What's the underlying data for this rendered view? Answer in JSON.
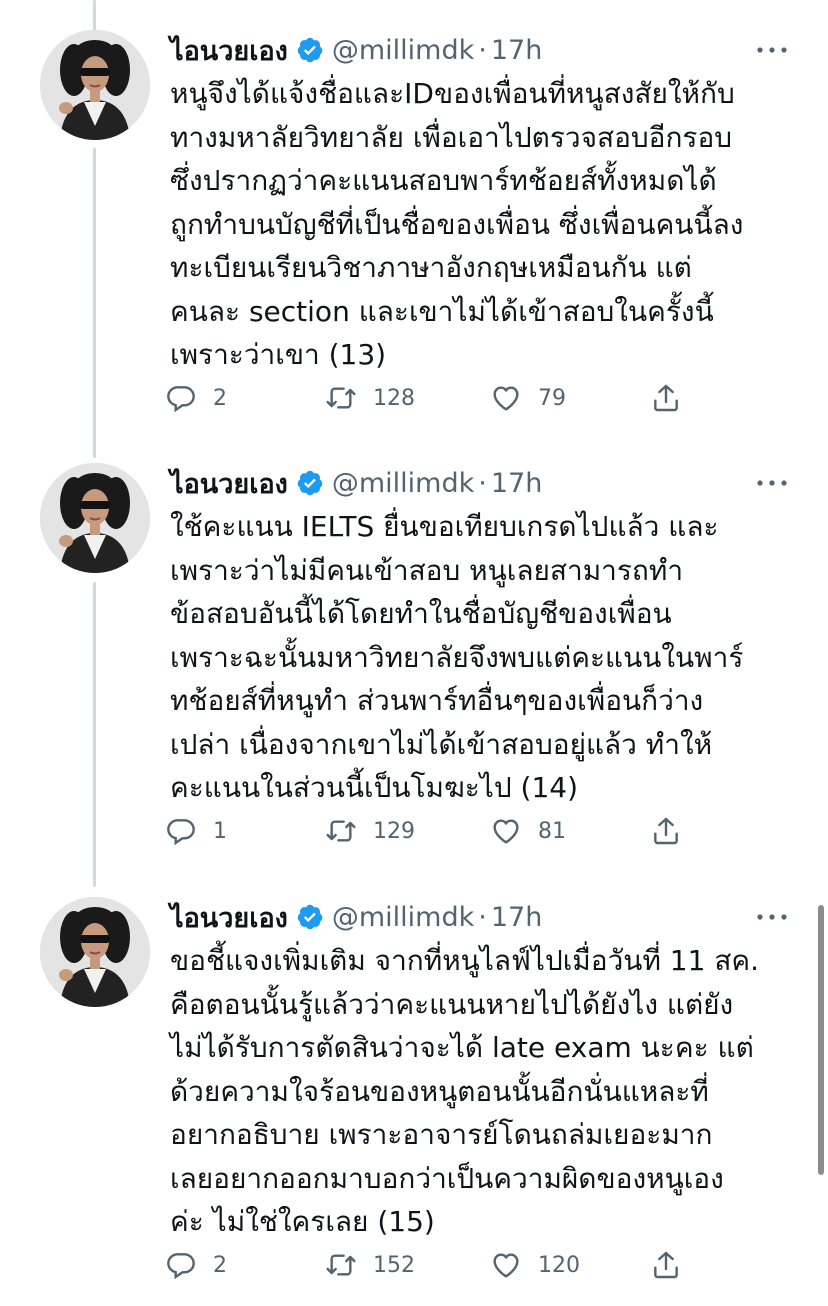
{
  "tweets": [
    {
      "display_name": "ไอนวยเอง",
      "handle": "@millimdk",
      "separator": "·",
      "time": "17h",
      "lines": [
        "หนูจึงได้แจ้งชื่อและIDของเพื่อนที่หนูสงสัยให้กับ",
        "ทางมหาลัยวิทยาลัย เพื่อเอาไปตรวจสอบอีกรอบ",
        "ซึ่งปรากฏว่าคะแนนสอบพาร์ทช้อยส์ทั้งหมดได้",
        "ถูกทำบนบัญชีที่เป็นชื่อของเพื่อน ซึ่งเพื่อนคนนี้ลง",
        "ทะเบียนเรียนวิชาภาษาอังกฤษเหมือนกัน แต่",
        "คนละ section และเขาไม่ได้เข้าสอบในครั้งนี้",
        "เพราะว่าเขา (13)"
      ],
      "replies": "2",
      "retweets": "128",
      "likes": "79"
    },
    {
      "display_name": "ไอนวยเอง",
      "handle": "@millimdk",
      "separator": "·",
      "time": "17h",
      "lines": [
        "ใช้คะแนน IELTS ยื่นขอเทียบเกรดไปแล้ว และ",
        "เพราะว่าไม่มีคนเข้าสอบ หนูเลยสามารถทำ",
        "ข้อสอบอันนี้ได้โดยทำในชื่อบัญชีของเพื่อน",
        "เพราะฉะนั้นมหาวิทยาลัยจึงพบแต่คะแนนในพาร์",
        "ทช้อยส์ที่หนูทำ ส่วนพาร์ทอื่นๆของเพื่อนก็ว่าง",
        "เปล่า เนื่องจากเขาไม่ได้เข้าสอบอยู่แล้ว ทำให้",
        "คะแนนในส่วนนี้เป็นโมฆะไป (14)"
      ],
      "replies": "1",
      "retweets": "129",
      "likes": "81"
    },
    {
      "display_name": "ไอนวยเอง",
      "handle": "@millimdk",
      "separator": "·",
      "time": "17h",
      "lines": [
        "ขอชี้แจงเพิ่มเติม จากที่หนูไลฟ์ไปเมื่อวันที่ 11 สค.",
        "คือตอนนั้นรู้แล้วว่าคะแนนหายไปได้ยังไง แต่ยัง",
        "ไม่ได้รับการตัดสินว่าจะได้ late exam นะคะ แต่",
        "ด้วยความใจร้อนของหนูตอนนั้นอีกนั่นแหละที่",
        "อยากอธิบาย เพราะอาจารย์โดนถล่มเยอะมาก",
        "เลยอยากออกมาบอกว่าเป็นความผิดของหนูเอง",
        "ค่ะ ไม่ใช่ใครเลย (15)"
      ],
      "replies": "2",
      "retweets": "152",
      "likes": "120"
    }
  ],
  "icons": {
    "verified": "verified-badge-icon",
    "more": "more-options-icon",
    "reply": "reply-icon",
    "retweet": "retweet-icon",
    "like": "heart-icon",
    "share": "share-icon"
  },
  "colors": {
    "verified": "#1d9bf0",
    "text": "#0f1419",
    "secondary": "#536471",
    "thread_line": "#cfd9de"
  }
}
